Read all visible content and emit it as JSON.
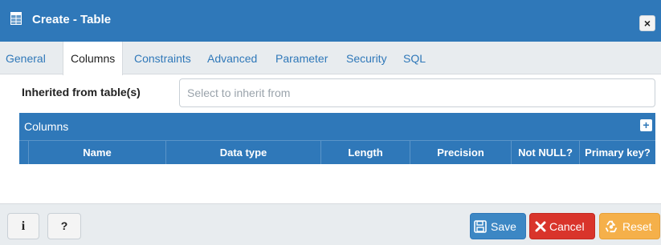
{
  "dialog": {
    "title": "Create - Table",
    "close_symbol": "×"
  },
  "tabs": [
    {
      "label": "General",
      "active": false
    },
    {
      "label": "Columns",
      "active": true
    },
    {
      "label": "Constraints",
      "active": false
    },
    {
      "label": "Advanced",
      "active": false
    },
    {
      "label": "Parameter",
      "active": false
    },
    {
      "label": "Security",
      "active": false
    },
    {
      "label": "SQL",
      "active": false
    }
  ],
  "inherit": {
    "label": "Inherited from table(s)",
    "placeholder": "Select to inherit from"
  },
  "columns_grid": {
    "title": "Columns",
    "add_symbol": "+",
    "headers": [
      "Name",
      "Data type",
      "Length",
      "Precision",
      "Not NULL?",
      "Primary key?"
    ]
  },
  "footer": {
    "info_symbol": "i",
    "help_symbol": "?",
    "save_label": "Save",
    "cancel_label": "Cancel",
    "reset_label": "Reset"
  },
  "icons": {
    "table_icon": "table-icon",
    "save_icon": "floppy-disk-icon",
    "cancel_icon": "x-mark-icon",
    "reset_icon": "recycle-icon"
  },
  "colors": {
    "header_blue": "#2f78b9",
    "cancel_red": "#d9342b",
    "reset_orange": "#f5b04a",
    "tab_link": "#2f78b9"
  }
}
